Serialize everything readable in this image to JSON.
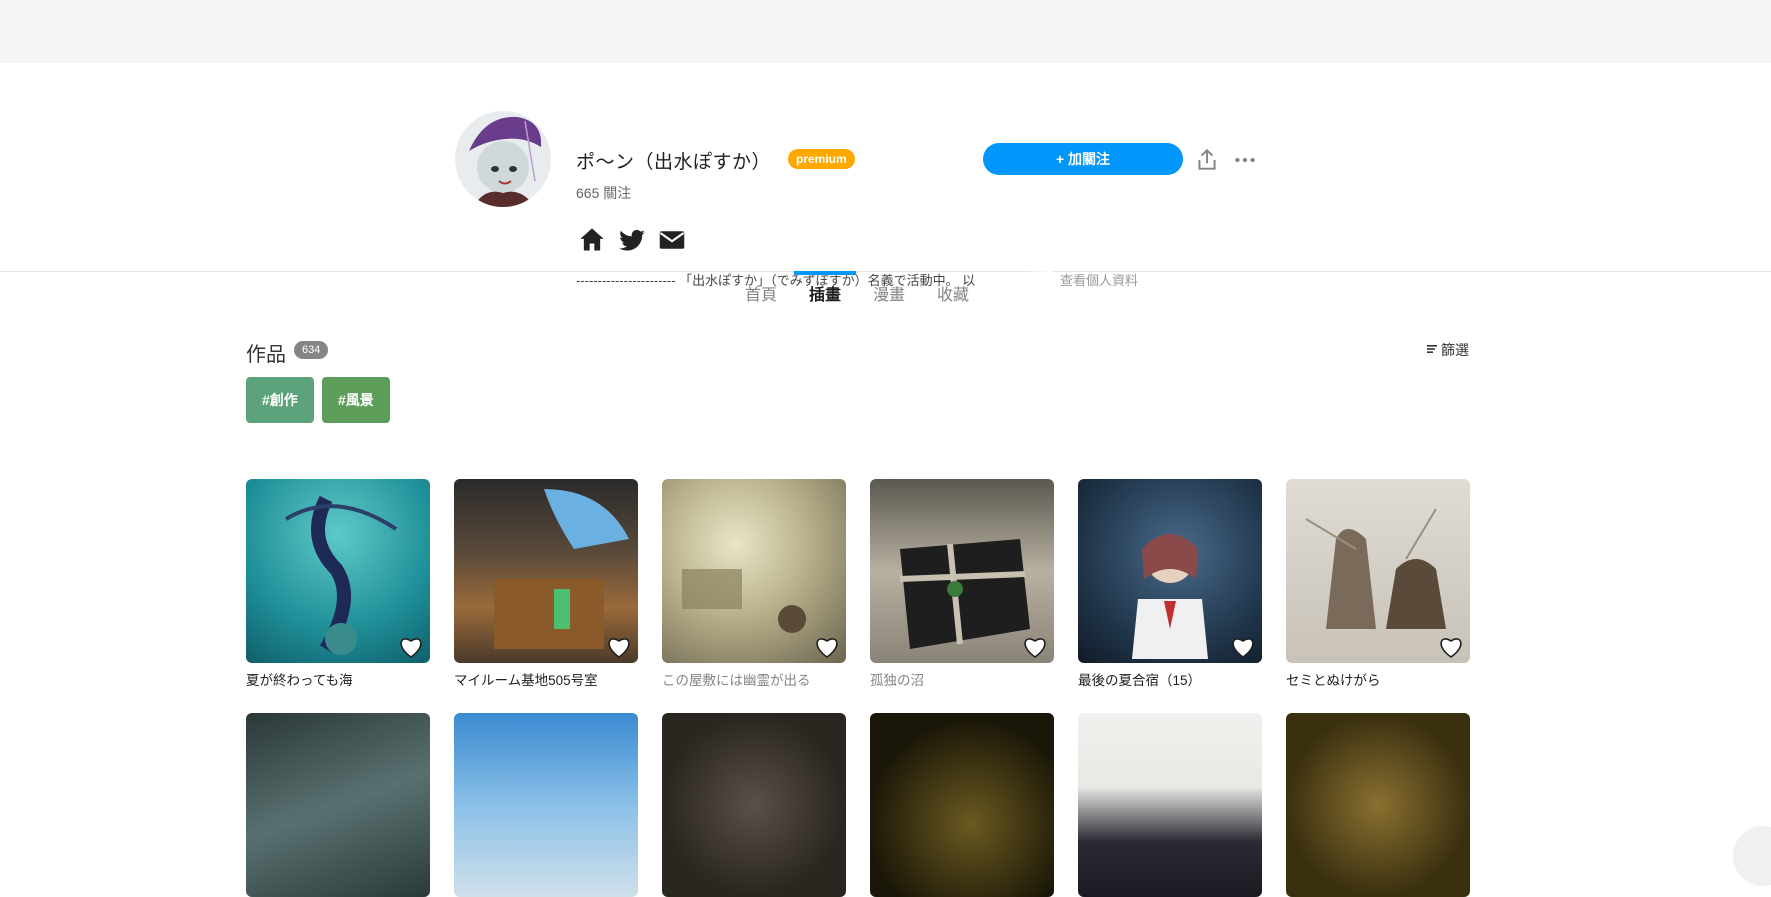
{
  "profile": {
    "name": "ポ～ン（出水ぽすか）",
    "premium_badge": "premium",
    "following_count": "665",
    "following_label": "關注",
    "bio": "----------------------- 「出水ぽすか」（でみずぽすか）名義で活動中。 以",
    "bio_more": "查看個人資料",
    "follow_button": "+ 加關注",
    "social_icons": [
      "home-icon",
      "twitter-icon",
      "mail-icon"
    ]
  },
  "tabs": [
    {
      "label": "首頁",
      "active": false
    },
    {
      "label": "插畫",
      "active": true
    },
    {
      "label": "漫畫",
      "active": false
    },
    {
      "label": "收藏",
      "active": false
    }
  ],
  "works": {
    "title": "作品",
    "count": "634",
    "filter_label": "篩選",
    "tags": [
      {
        "label": "#創作",
        "color": "#5ca27a"
      },
      {
        "label": "#風景",
        "color": "#5e9e5b"
      }
    ]
  },
  "gallery": {
    "row1": [
      {
        "title": "夏が終わっても海",
        "muted": false
      },
      {
        "title": "マイルーム基地505号室",
        "muted": false
      },
      {
        "title": "この屋敷には幽霊が出る",
        "muted": true
      },
      {
        "title": "孤独の沼",
        "muted": true
      },
      {
        "title": "最後の夏合宿（15）",
        "muted": false
      },
      {
        "title": "セミとぬけがら",
        "muted": false
      }
    ]
  },
  "colors": {
    "accent": "#0096fa",
    "premium": "#ffa800"
  }
}
